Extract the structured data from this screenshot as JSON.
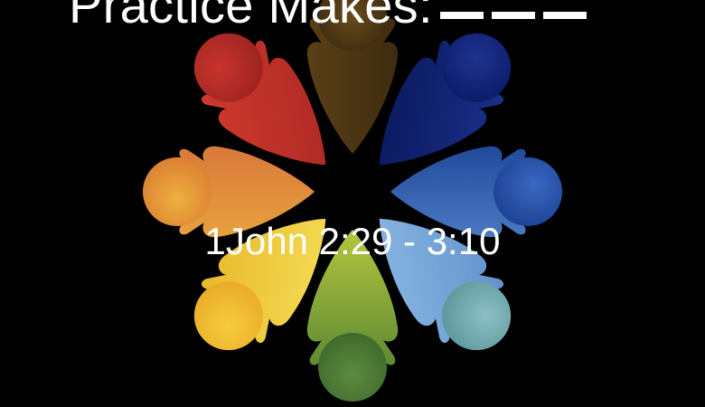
{
  "title": "Practice Makes:",
  "subtitle": "1John 2:29 - 3:10",
  "figures": [
    {
      "name": "figure-top",
      "color_body": "#4a3512",
      "color_head": "#5a3f16"
    },
    {
      "name": "figure-top-right",
      "color_body": "#0c1f6e",
      "color_head": "#142a80"
    },
    {
      "name": "figure-right",
      "color_body": "#2f5caa",
      "color_head": "#1f48a0"
    },
    {
      "name": "figure-bottom-right",
      "color_body": "#79a9d8",
      "color_head": "#6a9cb0"
    },
    {
      "name": "figure-bottom",
      "color_body": "#8ca83a",
      "color_head": "#4e7a36"
    },
    {
      "name": "figure-bottom-left",
      "color_body": "#f0d23a",
      "color_head": "#ecbf2e"
    },
    {
      "name": "figure-left",
      "color_body": "#e1903a",
      "color_head": "#e09a3c"
    },
    {
      "name": "figure-top-left",
      "color_body": "#c2302a",
      "color_head": "#b62a28"
    }
  ]
}
